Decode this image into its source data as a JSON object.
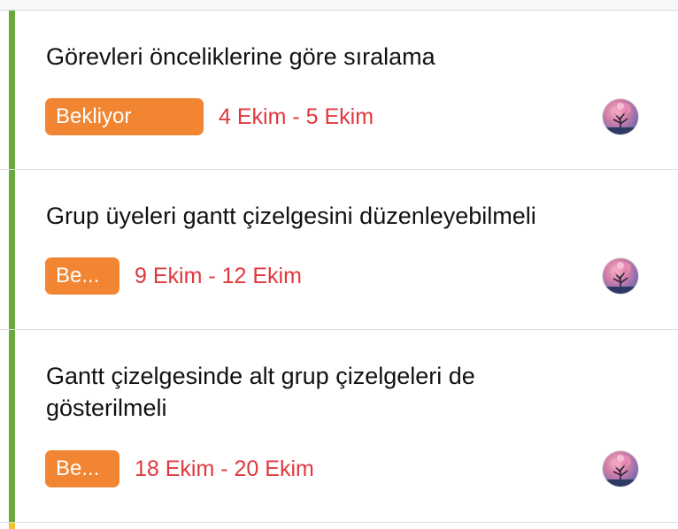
{
  "colors": {
    "stripe_green": "#6aa83c",
    "stripe_yellow": "#f2c230",
    "status_orange": "#f18532",
    "date_red": "#e0383e"
  },
  "tasks": [
    {
      "title": "Görevleri önceliklerine göre sıralama",
      "status": "Bekliyor",
      "dates": "4 Ekim - 5 Ekim",
      "avatar_icon": "tree-avatar-icon"
    },
    {
      "title": "Grup üyeleri gantt çizelgesini düzenleyebilmeli",
      "status": "Be...",
      "dates": "9 Ekim - 12 Ekim",
      "avatar_icon": "tree-avatar-icon"
    },
    {
      "title": "Gantt çizelgesinde alt grup çizelgeleri de gösterilmeli",
      "status": "Be...",
      "dates": "18 Ekim - 20 Ekim",
      "avatar_icon": "tree-avatar-icon"
    }
  ]
}
